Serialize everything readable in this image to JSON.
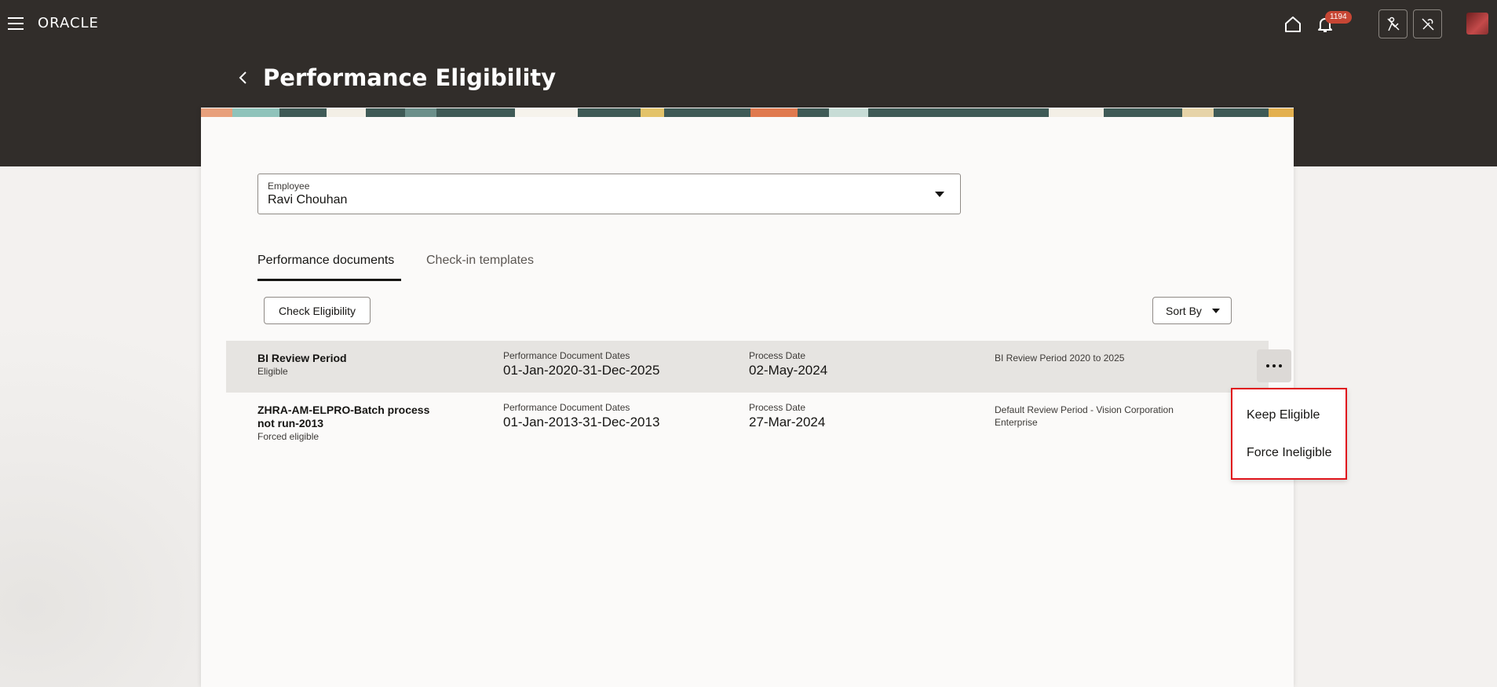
{
  "nav": {
    "logo": "ORACLE",
    "notification_count": "1194"
  },
  "page": {
    "title": "Performance Eligibility"
  },
  "employee": {
    "label": "Employee",
    "value": "Ravi Chouhan"
  },
  "tabs": [
    {
      "label": "Performance documents",
      "active": true
    },
    {
      "label": "Check-in templates",
      "active": false
    }
  ],
  "toolbar": {
    "check_label": "Check Eligibility",
    "sort_label": "Sort By"
  },
  "rows": [
    {
      "name": "BI Review Period",
      "status": "Eligible",
      "dates_label": "Performance Document Dates",
      "dates_value": "01-Jan-2020-31-Dec-2025",
      "process_label": "Process Date",
      "process_value": "02-May-2024",
      "description": "BI Review Period 2020 to 2025"
    },
    {
      "name": "ZHRA-AM-ELPRO-Batch process not run-2013",
      "status": "Forced eligible",
      "dates_label": "Performance Document Dates",
      "dates_value": "01-Jan-2013-31-Dec-2013",
      "process_label": "Process Date",
      "process_value": "27-Mar-2024",
      "description": "Default Review Period - Vision Corporation Enterprise"
    }
  ],
  "menu": {
    "items": [
      "Keep Eligible",
      "Force Ineligible"
    ]
  },
  "colors": {
    "header_bg": "#312d2a",
    "badge": "#c74634",
    "menu_highlight": "#e0151c"
  }
}
